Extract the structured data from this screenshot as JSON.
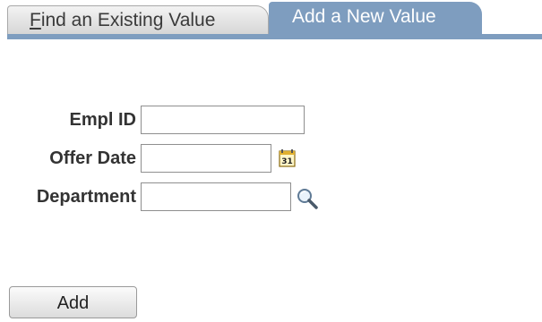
{
  "tabs": {
    "find": {
      "first_letter": "F",
      "rest": "ind an Existing Value"
    },
    "add": {
      "label": "Add a New Value"
    }
  },
  "form": {
    "empl_id": {
      "label": "Empl ID",
      "value": ""
    },
    "offer_date": {
      "label": "Offer Date",
      "value": ""
    },
    "department": {
      "label": "Department",
      "value": ""
    },
    "calendar_icon_text": "31"
  },
  "actions": {
    "add_label": "Add"
  },
  "colors": {
    "active_tab": "#7e9dbf",
    "inactive_tab": "#d6d6d6"
  },
  "icons": {
    "calendar": "calendar-icon",
    "lookup": "magnifier-icon"
  }
}
